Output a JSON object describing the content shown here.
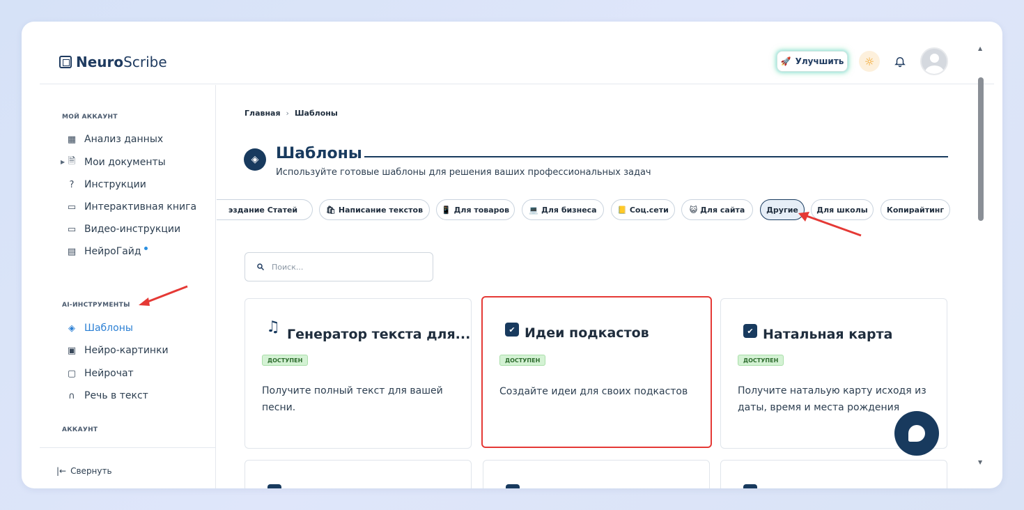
{
  "brand": {
    "name_bold": "Neuro",
    "name_light": "Scribe"
  },
  "header": {
    "upgrade_label": "Улучшить"
  },
  "sidebar": {
    "section_account": "МОЙ АККАУНТ",
    "items_account": [
      {
        "label": "Анализ данных",
        "icon": "grid-icon"
      },
      {
        "label": "Мои документы",
        "icon": "document-icon"
      },
      {
        "label": "Инструкции",
        "icon": "help-icon"
      },
      {
        "label": "Интерактивная книга",
        "icon": "book-icon"
      },
      {
        "label": "Видео-инструкции",
        "icon": "video-icon"
      },
      {
        "label": "НейроГайд",
        "icon": "layout-icon"
      }
    ],
    "section_tools": "AI-ИНСТРУМЕНТЫ",
    "items_tools": [
      {
        "label": "Шаблоны",
        "icon": "layers-icon"
      },
      {
        "label": "Нейро-картинки",
        "icon": "image-icon"
      },
      {
        "label": "Нейрочат",
        "icon": "chat-icon"
      },
      {
        "label": "Речь в текст",
        "icon": "headphones-icon"
      }
    ],
    "section_acc2": "АККАУНТ",
    "collapse_label": "Свернуть"
  },
  "breadcrumb": {
    "home": "Главная",
    "current": "Шаблоны"
  },
  "page": {
    "title": "Шаблоны",
    "subtitle": "Используйте готовые шаблоны для решения ваших профессиональных задач"
  },
  "chips": [
    {
      "label": "эздание Статей",
      "emoji": ""
    },
    {
      "label": "Написание текстов",
      "emoji": "🛍"
    },
    {
      "label": "Для товаров",
      "emoji": "📱"
    },
    {
      "label": "Для бизнеса",
      "emoji": "💻"
    },
    {
      "label": "Соц.сети",
      "emoji": "📒"
    },
    {
      "label": "Для сайта",
      "emoji": "😺"
    },
    {
      "label": "Другие",
      "emoji": ""
    },
    {
      "label": "Для школы",
      "emoji": ""
    },
    {
      "label": "Копирайтинг",
      "emoji": ""
    }
  ],
  "search": {
    "placeholder": "Поиск..."
  },
  "cards": [
    {
      "title": "Генератор текста для...",
      "badge": "ДОСТУПЕН",
      "desc": "Получите полный текст для вашей песни."
    },
    {
      "title": "Идеи подкастов",
      "badge": "ДОСТУПЕН",
      "desc": "Создайте идеи для своих подкастов"
    },
    {
      "title": "Натальная карта",
      "badge": "ДОСТУПЕН",
      "desc": "Получите натальую карту исходя из даты, время и места рождения"
    }
  ],
  "colors": {
    "accent": "#183a5e",
    "active_link": "#2a7fd4",
    "highlight": "#e53935",
    "badge_bg": "#d4f2d4"
  }
}
